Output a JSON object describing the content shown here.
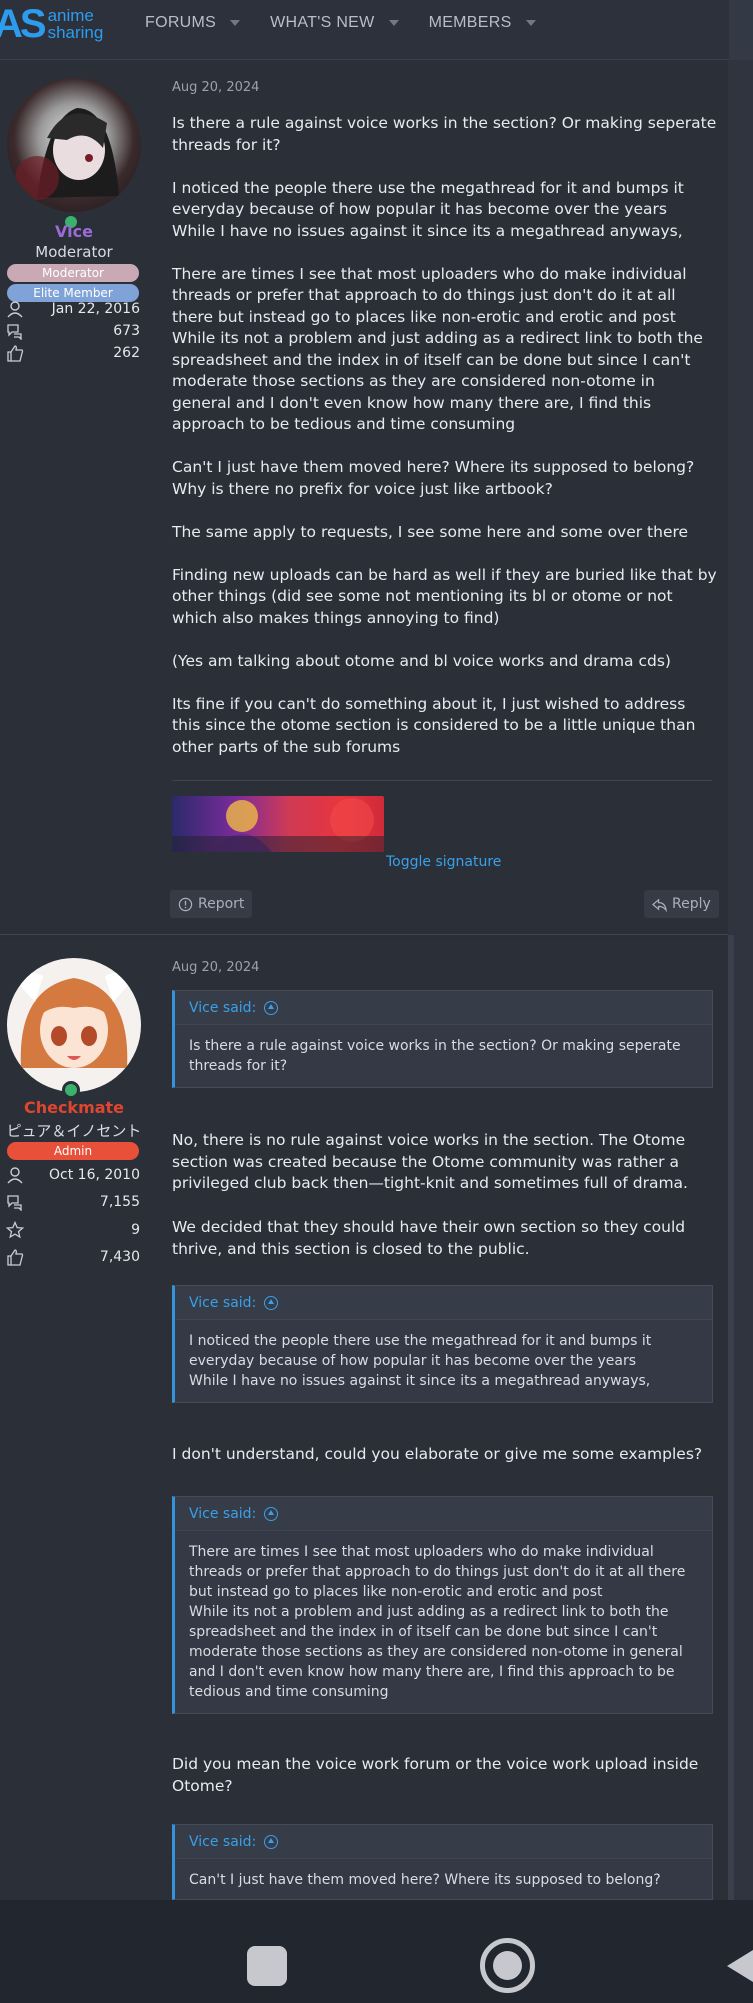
{
  "header": {
    "logo_mark": "AS",
    "logo_line1": "anime",
    "logo_line2": "sharing",
    "nav": [
      {
        "label": "FORUMS"
      },
      {
        "label": "WHAT'S NEW"
      },
      {
        "label": "MEMBERS"
      }
    ]
  },
  "post1": {
    "user": {
      "name": "Vice",
      "name_color": "#9b6bd6",
      "title": "Moderator",
      "banners": [
        {
          "label": "Moderator",
          "color": "#c9a9b4"
        },
        {
          "label": "Elite Member",
          "color": "#7fa3d6"
        }
      ],
      "joined": "Jan 22, 2016",
      "messages": "673",
      "reactions": "262"
    },
    "date": "Aug 20, 2024",
    "paragraphs": [
      "Is there a rule against voice works in the section? Or making seperate threads for it?",
      "I noticed the people there use the megathread for it and bumps it everyday because of how popular it has become over the years\nWhile I have no issues against it since its a megathread anyways,",
      "There are times I see that most uploaders who do make individual threads or prefer that approach to do things just don't do it at all there but instead go to places like non-erotic and erotic and post\nWhile its not a problem and just adding as a redirect link to both the spreadsheet and the index in of itself can be done but since I can't moderate those sections as they are considered non-otome in general and I don't even know how many there are, I find this approach to be tedious and time consuming",
      "Can't I just have them moved here? Where its supposed to belong?\nWhy is there no prefix for voice just like artbook?",
      "The same apply to requests, I see some here and some over there",
      "Finding new uploads can be hard as well if they are buried like that by other things (did see some not mentioning its bl or otome or not which also makes things annoying to find)",
      "(Yes am talking about otome and bl voice works and drama cds)",
      "Its fine if you can't do something about it, I just wished to address this since the otome section is considered to be a little unique than other parts of the sub forums"
    ],
    "toggle_signature": "Toggle signature",
    "report_label": "Report",
    "reply_label": "Reply"
  },
  "post2": {
    "user": {
      "name": "Checkmate",
      "name_color": "#e0452f",
      "title": "ピュア＆イノセント",
      "banners": [
        {
          "label": "Admin",
          "color": "#e8503a"
        }
      ],
      "joined": "Oct 16, 2010",
      "messages": "7,155",
      "points": "9",
      "reactions": "7,430"
    },
    "date": "Aug 20, 2024",
    "quote1": {
      "author": "Vice said:",
      "text": "Is there a rule against voice works in the section? Or making seperate threads for it?"
    },
    "reply1": "No, there is no rule against voice works in the section. The Otome section was created because the Otome community was rather a privileged club back then—tight-knit and sometimes full of drama.",
    "reply2": "We decided that they should have their own section so they could thrive, and this section is closed to the public.",
    "quote2": {
      "author": "Vice said:",
      "text": "I noticed the people there use the megathread for it and bumps it everyday because of how popular it has become over the years\nWhile I have no issues against it since its a megathread anyways,"
    },
    "reply3": "I don't understand, could you elaborate or give me some examples?",
    "quote3": {
      "author": "Vice said:",
      "text": "There are times I see that most uploaders who do make individual threads or prefer that approach to do things just don't do it at all there but instead go to places like non-erotic and erotic and post\nWhile its not a problem and just adding as a redirect link to both the spreadsheet and the index in of itself can be done but since I can't moderate those sections as they are considered non-otome in general and I don't even know how many there are, I find this approach to be tedious and time consuming"
    },
    "reply4": "Did you mean the voice work forum or the voice work upload inside Otome?",
    "quote4": {
      "author": "Vice said:",
      "text": "Can't I just have them moved here? Where its supposed to belong?"
    }
  }
}
